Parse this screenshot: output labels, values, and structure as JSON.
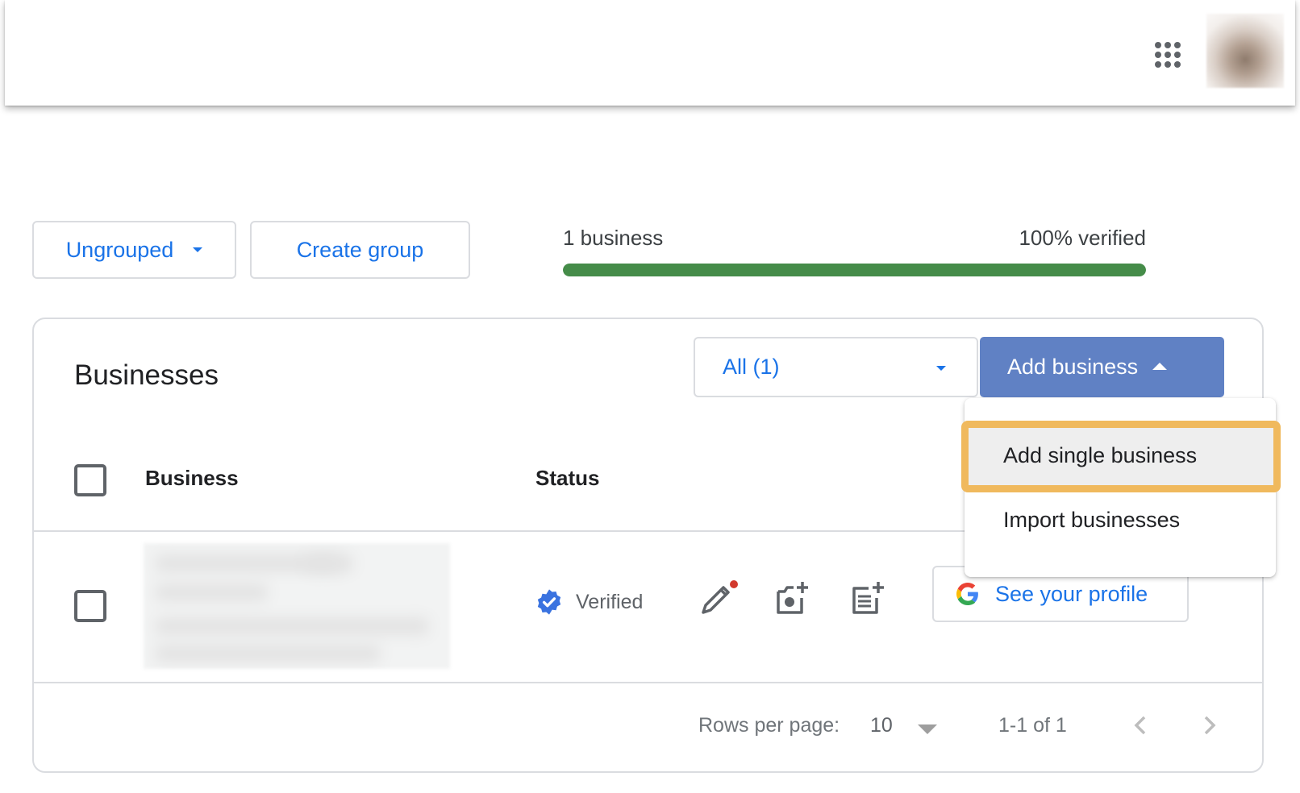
{
  "header": {
    "apps_icon": "google-apps-grid-icon",
    "avatar": "account-avatar"
  },
  "toolbar": {
    "group_select_label": "Ungrouped",
    "create_group_label": "Create group"
  },
  "summary": {
    "business_count_label": "1 business",
    "verified_label": "100% verified",
    "verified_percent": 100,
    "progress_color": "#458c49"
  },
  "card": {
    "title": "Businesses",
    "filter": {
      "selected": "All (1)"
    },
    "add_business_label": "Add business",
    "add_business_color": "#6081c4",
    "columns": [
      "Business",
      "Status"
    ],
    "rows": [
      {
        "name": "[redacted]",
        "status": "Verified",
        "actions": [
          "edit-profile-icon",
          "add-photo-icon",
          "add-post-icon"
        ],
        "profile_button_label": "See your profile"
      }
    ],
    "pagination": {
      "rows_per_page_label": "Rows per page:",
      "rows_per_page_value": "10",
      "range_label": "1-1 of 1"
    }
  },
  "dropdown_menu": {
    "items": [
      {
        "label": "Add single business",
        "highlighted": true
      },
      {
        "label": "Import businesses",
        "highlighted": false
      }
    ],
    "highlight_color": "#f0b95d"
  },
  "colors": {
    "link_blue": "#1a73e8",
    "verified_badge": "#3a73e0",
    "notification_dot": "#d2392d"
  }
}
